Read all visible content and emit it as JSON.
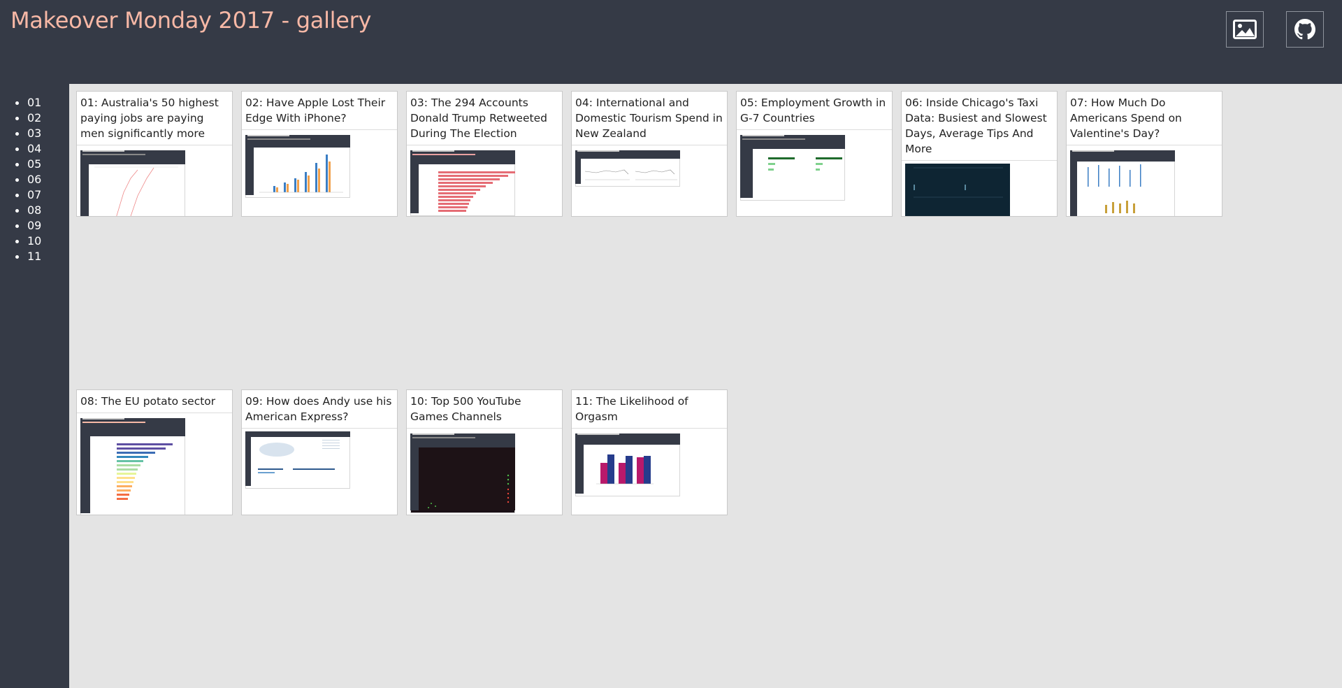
{
  "header": {
    "title": "Makeover Monday 2017 - gallery",
    "buttons": [
      {
        "name": "image-icon",
        "label": "gallery image"
      },
      {
        "name": "github-icon",
        "label": "github"
      }
    ]
  },
  "sidebar": {
    "items": [
      "01",
      "02",
      "03",
      "04",
      "05",
      "06",
      "07",
      "08",
      "09",
      "10",
      "11"
    ]
  },
  "cards": [
    {
      "caption": "01: Australia's 50 highest paying jobs are paying men significantly more"
    },
    {
      "caption": "02: Have Apple Lost Their Edge With iPhone?"
    },
    {
      "caption": "03: The 294 Accounts Donald Trump Retweeted During The Election"
    },
    {
      "caption": "04: International and Domestic Tourism Spend in New Zealand"
    },
    {
      "caption": "05: Employment Growth in G-7 Countries"
    },
    {
      "caption": "06: Inside Chicago's Taxi Data: Busiest and Slowest Days, Average Tips And More"
    },
    {
      "caption": "07: How Much Do Americans Spend on Valentine's Day?"
    },
    {
      "caption": "08: The EU potato sector"
    },
    {
      "caption": "09: How does Andy use his American Express?"
    },
    {
      "caption": "10: Top 500 YouTube Games Channels"
    },
    {
      "caption": "11: The Likelihood of Orgasm"
    }
  ],
  "colors": {
    "background": "#353a46",
    "title": "#f7b8a6",
    "content_bg": "#e4e4e4"
  }
}
